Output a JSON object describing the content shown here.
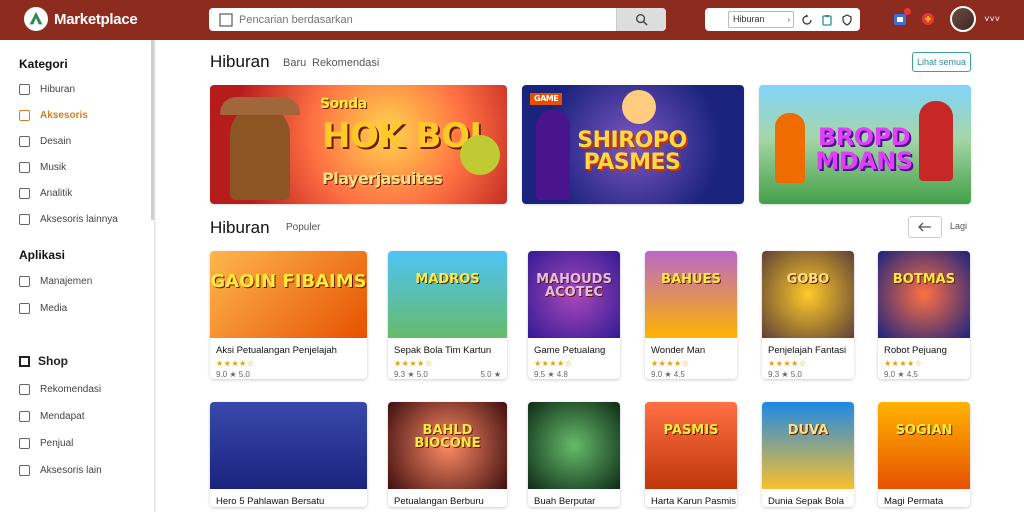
{
  "app": {
    "name": "Marketplace"
  },
  "search": {
    "placeholder": "Pencarian berdasarkan"
  },
  "filter": {
    "select_label": "Hiburan"
  },
  "sidebar": {
    "section1_title": "Kategori",
    "section1_items": [
      {
        "label": "Hiburan",
        "active": false
      },
      {
        "label": "Aksesoris",
        "active": true
      },
      {
        "label": "Desain",
        "active": false
      },
      {
        "label": "Musik",
        "active": false
      },
      {
        "label": "Analitik",
        "active": false
      },
      {
        "label": "Aksesoris lainnya",
        "active": false
      }
    ],
    "section2_title": "Aplikasi",
    "section2_items": [
      {
        "label": "Manajemen"
      },
      {
        "label": "Media"
      }
    ],
    "section3_title": "Shop",
    "section3_items": [
      {
        "label": "Rekomendasi"
      },
      {
        "label": "Mendapat"
      },
      {
        "label": "Penjual"
      },
      {
        "label": "Aksesoris lain"
      }
    ]
  },
  "main": {
    "section1": {
      "title": "Hiburan",
      "tab1": "Baru",
      "tab2": "Rekomendasi",
      "button": "Lihat semua"
    },
    "banners": [
      {
        "title": "HOK BOI",
        "subtitle": "Playerjasuites",
        "tag": "Sonda"
      },
      {
        "title": "SHIROPO PASMES",
        "tag": "GAME"
      },
      {
        "title": "BROPD MDANS",
        "tag": ""
      }
    ],
    "section2": {
      "title": "Hiburan",
      "subtitle": "Populer",
      "more": "Lagi"
    },
    "cards_row1": [
      {
        "name": "Aksi Petualangan Penjelajah",
        "stars": "★★★★☆",
        "meta_left": "9.0 ★ 5.0",
        "meta_right": "",
        "art": "GAOIN FIBAIMS"
      },
      {
        "name": "Sepak Bola Tim Kartun",
        "stars": "★★★★☆",
        "meta_left": "9.3 ★ 5.0",
        "meta_right": "5.0 ★",
        "art": "MADROS"
      },
      {
        "name": "Game Petualang",
        "stars": "★★★★☆",
        "meta_left": "9.5 ★ 4.8",
        "meta_right": "",
        "art": "MAHOUDS ACOTEC"
      },
      {
        "name": "Wonder Man",
        "stars": "★★★★☆",
        "meta_left": "9.0 ★ 4.5",
        "meta_right": "",
        "art": "BAHUES"
      },
      {
        "name": "Penjelajah Fantasi",
        "stars": "★★★★☆",
        "meta_left": "9.3 ★ 5.0",
        "meta_right": "",
        "art": "GOBO"
      },
      {
        "name": "Robot Pejuang",
        "stars": "★★★★☆",
        "meta_left": "9.0 ★ 4.5",
        "meta_right": "",
        "art": "BOTMAS"
      }
    ],
    "cards_row2": [
      {
        "name": "Hero 5 Pahlawan Bersatu",
        "art": ""
      },
      {
        "name": "Petualangan Berburu",
        "art": "BAHLD BIOCONE"
      },
      {
        "name": "Buah Berputar",
        "art": ""
      },
      {
        "name": "Harta Karun Pasmis",
        "art": "PASMIS"
      },
      {
        "name": "Dunia Sepak Bola",
        "art": "DUVA"
      },
      {
        "name": "Magi Permata",
        "art": "SOGIAN"
      }
    ]
  },
  "colors": {
    "topbar": "#8e2b1f",
    "accent": "#d4801a",
    "teal": "#2b8f97"
  }
}
